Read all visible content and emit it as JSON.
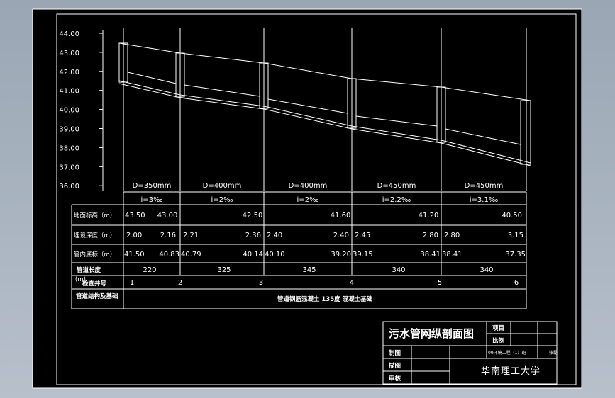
{
  "y_axis_ticks": [
    "44.00",
    "43.00",
    "42.00",
    "41.00",
    "40.00",
    "39.00",
    "38.00",
    "37.00",
    "36.00"
  ],
  "segments": [
    {
      "diameter": "D=350mm",
      "slope": "i=3‰"
    },
    {
      "diameter": "D=400mm",
      "slope": "i=2‰"
    },
    {
      "diameter": "D=400mm",
      "slope": "i=2‰"
    },
    {
      "diameter": "D=450mm",
      "slope": "i=2.2‰"
    },
    {
      "diameter": "D=450mm",
      "slope": "i=3.1‰"
    }
  ],
  "row_labels": {
    "ground": "地面标高（m）",
    "depth": "埋设深度（m）",
    "invert": "管内底标（m）",
    "length": "管道长度",
    "length_unit": "(m)",
    "well": "检查井号",
    "structure": "管道结构及基础"
  },
  "ground_elev": [
    "43.50",
    "43.00",
    "42.50",
    "41.60",
    "41.20",
    "40.50"
  ],
  "depth": [
    [
      "2.00",
      "2.16"
    ],
    [
      "2.21",
      "2.36"
    ],
    [
      "2.40",
      "2.40"
    ],
    [
      "2.45",
      "2.80"
    ],
    [
      "2.80",
      "3.15"
    ]
  ],
  "invert": [
    [
      "41.50",
      "40.83"
    ],
    [
      "40.79",
      "40.14"
    ],
    [
      "40.10",
      "39.20"
    ],
    [
      "39.15",
      "38.41"
    ],
    [
      "38.41",
      "37.35"
    ]
  ],
  "lengths": [
    "220",
    "325",
    "345",
    "340",
    "340"
  ],
  "wells": [
    "1",
    "2",
    "3",
    "4",
    "5",
    "6"
  ],
  "structure_text": "管道钢筋混凝土 135度 混凝土基础",
  "title_block": {
    "drawing_title": "污水管网纵剖面图",
    "project_label": "项目",
    "scale_label": "比例",
    "drawn_label": "制图",
    "checked_label": "描图",
    "review_label": "审核",
    "class_text": "09环境工程（1）班",
    "name_text": "张磊",
    "school": "华南理工大学"
  }
}
